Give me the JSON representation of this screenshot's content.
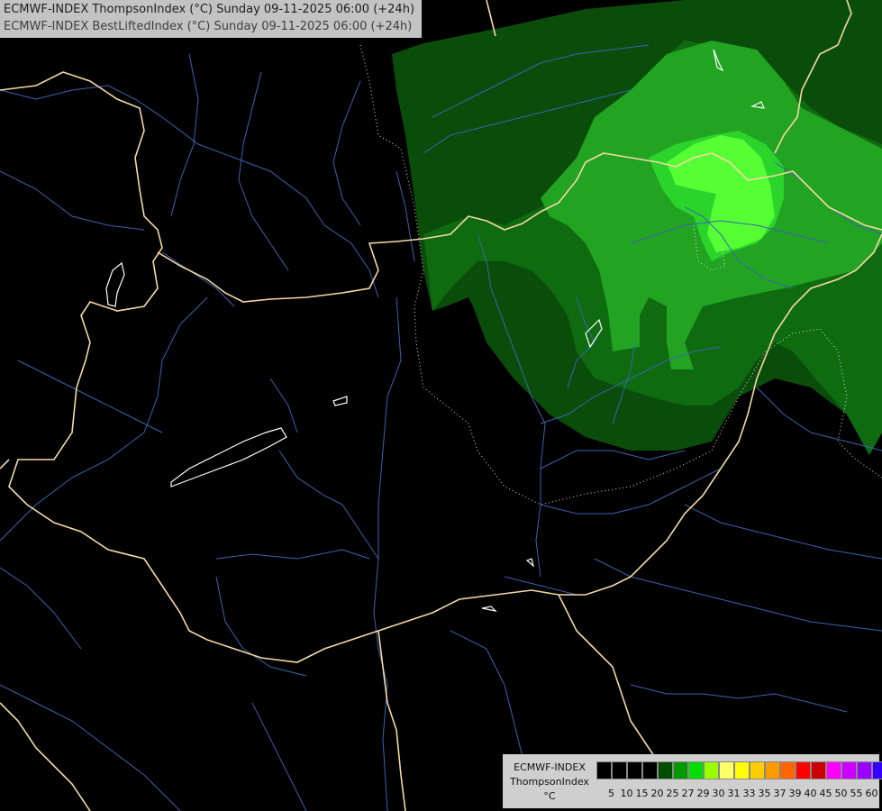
{
  "header": {
    "line1": "ECMWF-INDEX ThompsonIndex (°C) Sunday 09-11-2025 06:00 (+24h)",
    "line2": "ECMWF-INDEX BestLiftedIndex (°C) Sunday 09-11-2025 06:00 (+24h)"
  },
  "legend": {
    "model": "ECMWF-INDEX",
    "parameter": "ThompsonIndex",
    "unit": "°C",
    "ticks": [
      "5",
      "10",
      "15",
      "20",
      "25",
      "27",
      "29",
      "30",
      "31",
      "33",
      "35",
      "37",
      "39",
      "40",
      "45",
      "50",
      "55",
      "60"
    ],
    "colors": [
      "#000000",
      "#000000",
      "#000000",
      "#000000",
      "#004d00",
      "#009900",
      "#00dd00",
      "#99ff00",
      "#ffff66",
      "#ffff00",
      "#ffcc00",
      "#ff9900",
      "#ff6600",
      "#ff0000",
      "#cc0000",
      "#ff00ff",
      "#cc00ff",
      "#9900ff",
      "#3300ff"
    ]
  },
  "map": {
    "colors": {
      "background": "#000000",
      "dark_green": "#003b00",
      "mid_green": "#006600",
      "green": "#119911",
      "light_green": "#22bb22",
      "bright_green": "#33ff33",
      "border": "#f5d9a6",
      "river": "#3a64b0",
      "lake": "#ffffff"
    }
  }
}
